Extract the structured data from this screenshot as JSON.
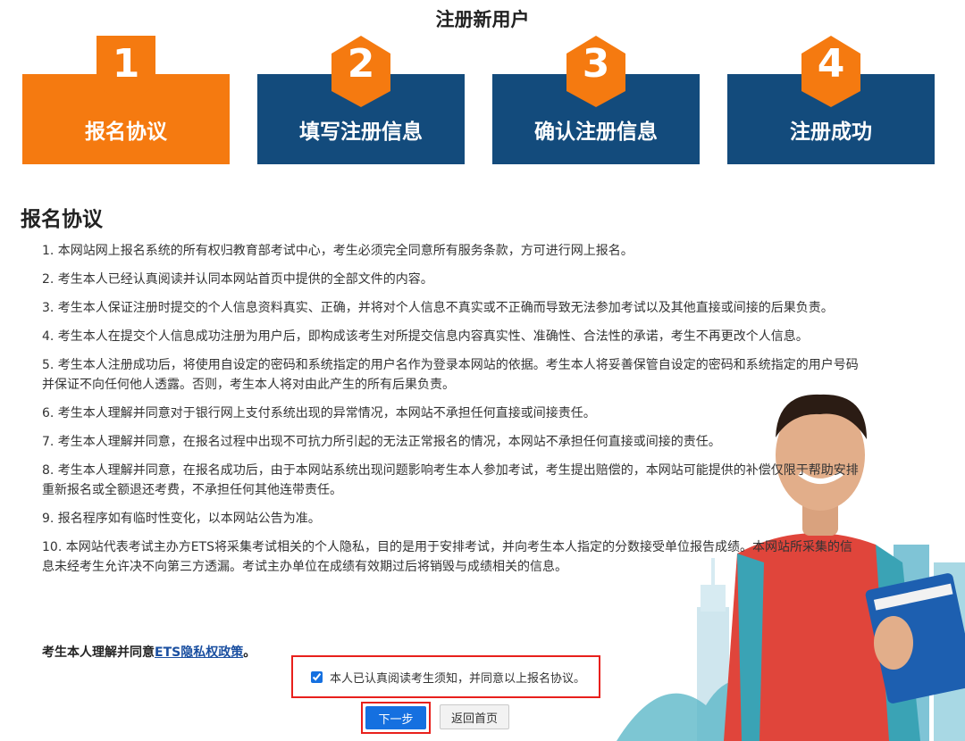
{
  "page_title": "注册新用户",
  "steps": [
    {
      "num": "1",
      "label": "报名协议"
    },
    {
      "num": "2",
      "label": "填写注册信息"
    },
    {
      "num": "3",
      "label": "确认注册信息"
    },
    {
      "num": "4",
      "label": "注册成功"
    }
  ],
  "section_title": "报名协议",
  "agreement_items": [
    "1. 本网站网上报名系统的所有权归教育部考试中心，考生必须完全同意所有服务条款，方可进行网上报名。",
    "2. 考生本人已经认真阅读并认同本网站首页中提供的全部文件的内容。",
    "3. 考生本人保证注册时提交的个人信息资料真实、正确，并将对个人信息不真实或不正确而导致无法参加考试以及其他直接或间接的后果负责。",
    "4. 考生本人在提交个人信息成功注册为用户后，即构成该考生对所提交信息内容真实性、准确性、合法性的承诺，考生不再更改个人信息。",
    "5. 考生本人注册成功后，将使用自设定的密码和系统指定的用户名作为登录本网站的依据。考生本人将妥善保管自设定的密码和系统指定的用户号码并保证不向任何他人透露。否则，考生本人将对由此产生的所有后果负责。",
    "6. 考生本人理解并同意对于银行网上支付系统出现的异常情况，本网站不承担任何直接或间接责任。",
    "7. 考生本人理解并同意，在报名过程中出现不可抗力所引起的无法正常报名的情况，本网站不承担任何直接或间接的责任。",
    "8. 考生本人理解并同意，在报名成功后，由于本网站系统出现问题影响考生本人参加考试，考生提出赔偿的，本网站可能提供的补偿仅限于帮助安排重新报名或全额退还考费，不承担任何其他连带责任。",
    "9. 报名程序如有临时性变化，以本网站公告为准。",
    "10. 本网站代表考试主办方ETS将采集考试相关的个人隐私，目的是用于安排考试，并向考生本人指定的分数接受单位报告成绩。本网站所采集的信息未经考生允许决不向第三方透漏。考试主办单位在成绩有效期过后将销毁与成绩相关的信息。"
  ],
  "consent_prefix": "考生本人理解并同意",
  "consent_link": "ETS隐私权政策",
  "consent_suffix": "。",
  "checkbox_label": "本人已认真阅读考生须知，并同意以上报名协议。",
  "next_button": "下一步",
  "home_button": "返回首页",
  "colors": {
    "active": "#f57a10",
    "inactive": "#134b7c",
    "highlight": "#e8201c",
    "primary": "#1570e0"
  }
}
